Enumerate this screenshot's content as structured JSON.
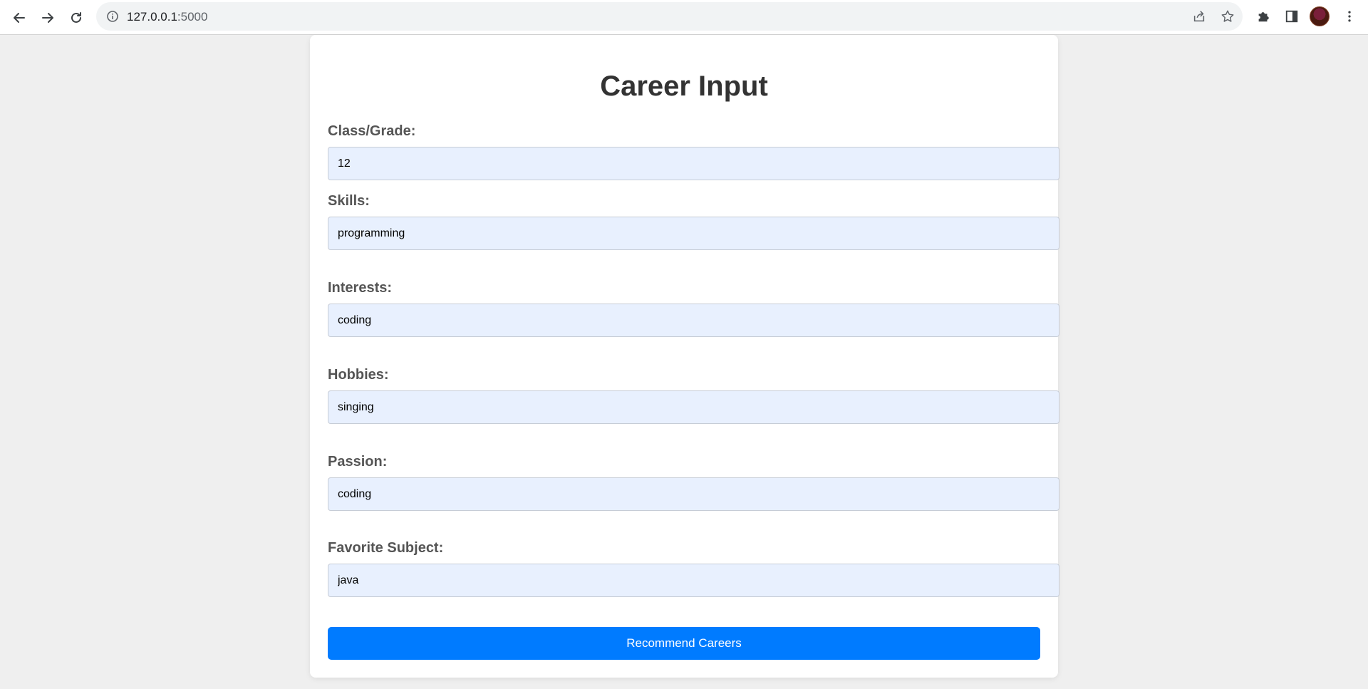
{
  "browser": {
    "url_host": "127.0.0.1",
    "url_port": ":5000"
  },
  "form": {
    "title": "Career Input",
    "fields": [
      {
        "label": "Class/Grade:",
        "value": "12"
      },
      {
        "label": "Skills:",
        "value": "programming"
      },
      {
        "label": "Interests:",
        "value": "coding"
      },
      {
        "label": "Hobbies:",
        "value": "singing"
      },
      {
        "label": "Passion:",
        "value": "coding"
      },
      {
        "label": "Favorite Subject:",
        "value": "java"
      }
    ],
    "submit_label": "Recommend Careers"
  },
  "colors": {
    "button": "#007bff",
    "input_background": "#e8f0fe",
    "page_background": "#efefef"
  },
  "icons": [
    "back-arrow-icon",
    "forward-arrow-icon",
    "reload-icon",
    "info-icon",
    "share-icon",
    "star-icon",
    "puzzle-icon",
    "side-panel-icon",
    "menu-dots-icon"
  ]
}
